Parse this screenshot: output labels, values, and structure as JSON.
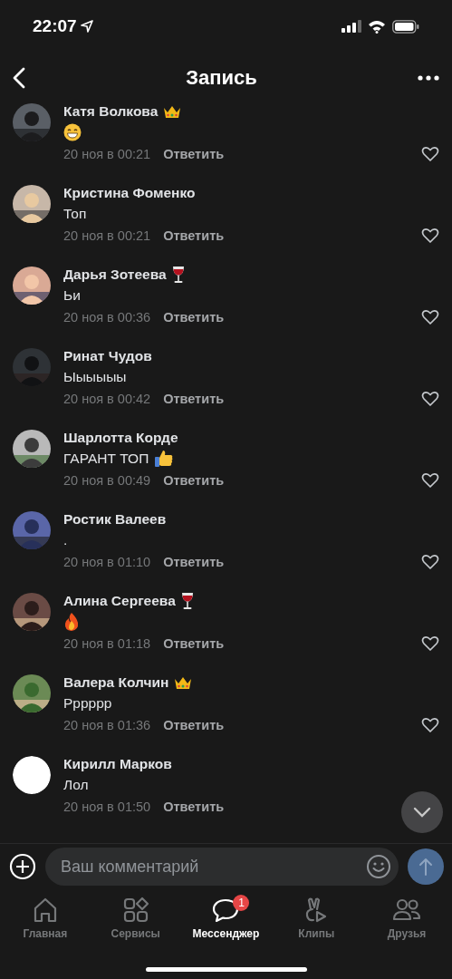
{
  "status_bar": {
    "time": "22:07"
  },
  "header": {
    "title": "Запись"
  },
  "comments": [
    {
      "author": "Катя Волкова",
      "date": "20 ноя в 00:21",
      "reply": "Ответить"
    },
    {
      "author": "Кристина Фоменко",
      "message": "Топ",
      "date": "20 ноя в 00:21",
      "reply": "Ответить"
    },
    {
      "author": "Дарья Зотеева",
      "message": "Ьи",
      "date": "20 ноя в 00:36",
      "reply": "Ответить"
    },
    {
      "author": "Ринат Чудов",
      "message": "Ыыыыыы",
      "date": "20 ноя в 00:42",
      "reply": "Ответить"
    },
    {
      "author": "Шарлотта Корде",
      "message": "ГАРАНТ ТОП",
      "date": "20 ноя в 00:49",
      "reply": "Ответить"
    },
    {
      "author": "Ростик Валеев",
      "message": ".",
      "date": "20 ноя в 01:10",
      "reply": "Ответить"
    },
    {
      "author": "Алина Сергеева",
      "date": "20 ноя в 01:18",
      "reply": "Ответить"
    },
    {
      "author": "Валера Колчин",
      "message": "Рррррр",
      "date": "20 ноя в 01:36",
      "reply": "Ответить"
    },
    {
      "author": "Кирилл Марков",
      "message": "Лол",
      "date": "20 ноя в 01:50",
      "reply": "Ответить"
    }
  ],
  "composer": {
    "placeholder": "Ваш комментарий"
  },
  "tabs": [
    {
      "label": "Главная",
      "selected": false
    },
    {
      "label": "Сервисы",
      "selected": false
    },
    {
      "label": "Мессенджер",
      "selected": true,
      "badge": "1"
    },
    {
      "label": "Клипы",
      "selected": false
    },
    {
      "label": "Друзья",
      "selected": false
    }
  ]
}
